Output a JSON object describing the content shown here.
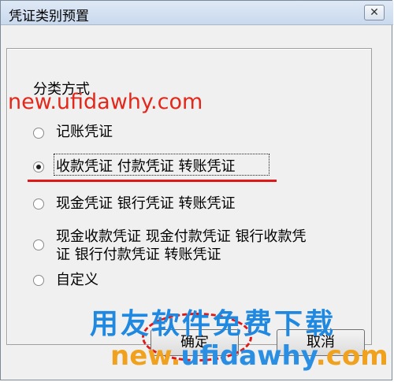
{
  "window": {
    "title": "凭证类别预置",
    "close_glyph": "✕"
  },
  "group": {
    "label": "分类方式"
  },
  "options": [
    {
      "label": "记账凭证",
      "selected": false
    },
    {
      "label": "收款凭证 付款凭证 转账凭证",
      "selected": true
    },
    {
      "label": "现金凭证 银行凭证 转账凭证",
      "selected": false
    },
    {
      "label_line1": "现金收款凭证 现金付款凭证 银行收款凭",
      "label_line2": "证 银行付款凭证 转账凭证",
      "selected": false
    },
    {
      "label": "自定义",
      "selected": false
    }
  ],
  "buttons": {
    "ok": "确定",
    "cancel": "取消"
  },
  "watermarks": {
    "url_top": "new.ufidawhy.com",
    "slogan": "用友软件免费下载",
    "url_bottom_prefix": "new.",
    "url_bottom_main": "ufidawhy",
    "url_bottom_suffix": ".com"
  },
  "colors": {
    "annotation_red": "#e01818",
    "slogan_blue": "#1f88e0",
    "url_orange": "#f0a21e"
  }
}
